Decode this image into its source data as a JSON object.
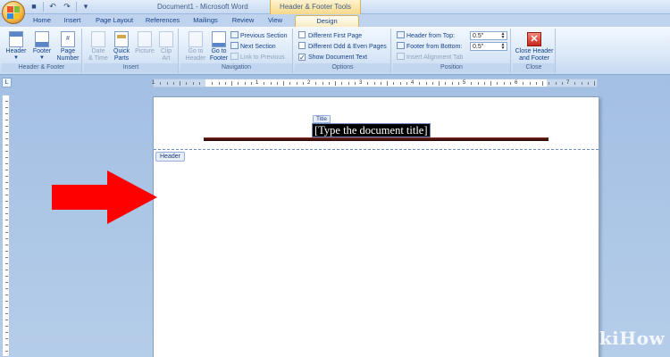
{
  "window": {
    "title": "Document1 - Microsoft Word",
    "contextual_tab_group": "Header & Footer Tools"
  },
  "quick_access": [
    "save-icon",
    "undo-icon",
    "redo-icon",
    "customize-icon"
  ],
  "tabs": [
    {
      "label": "Home",
      "active": false
    },
    {
      "label": "Insert",
      "active": false
    },
    {
      "label": "Page Layout",
      "active": false
    },
    {
      "label": "References",
      "active": false
    },
    {
      "label": "Mailings",
      "active": false
    },
    {
      "label": "Review",
      "active": false
    },
    {
      "label": "View",
      "active": false
    },
    {
      "label": "Design",
      "active": true
    }
  ],
  "ribbon": {
    "header_footer": {
      "label": "Header & Footer",
      "header": "Header",
      "footer": "Footer",
      "page_number_line1": "Page",
      "page_number_line2": "Number"
    },
    "insert": {
      "label": "Insert",
      "date_line1": "Date",
      "date_line2": "& Time",
      "quick_line1": "Quick",
      "quick_line2": "Parts",
      "picture": "Picture",
      "clip_line1": "Clip",
      "clip_line2": "Art"
    },
    "navigation": {
      "label": "Navigation",
      "goto_header_line1": "Go to",
      "goto_header_line2": "Header",
      "goto_footer_line1": "Go to",
      "goto_footer_line2": "Footer",
      "previous_section": "Previous Section",
      "next_section": "Next Section",
      "link_to_previous": "Link to Previous"
    },
    "options": {
      "label": "Options",
      "different_first_page": "Different First Page",
      "different_odd_even": "Different Odd & Even Pages",
      "show_document_text": "Show Document Text",
      "different_first_page_checked": false,
      "different_odd_even_checked": false,
      "show_document_text_checked": true
    },
    "position": {
      "label": "Position",
      "header_from_top_label": "Header from Top:",
      "header_from_top_value": "0.5\"",
      "footer_from_bottom_label": "Footer from Bottom:",
      "footer_from_bottom_value": "0.5\"",
      "insert_alignment_tab": "Insert Alignment Tab"
    },
    "close": {
      "label": "Close",
      "close_line1": "Close Header",
      "close_line2": "and Footer"
    }
  },
  "ruler_numbers": [
    "1",
    "1",
    "2",
    "3",
    "4",
    "5",
    "6",
    "7"
  ],
  "document": {
    "title_tag": "Title",
    "title_placeholder": "[Type the document title]",
    "header_tag": "Header"
  },
  "watermark": "wikiHow",
  "colors": {
    "ribbon_text": "#15428b",
    "contextual_tab": "#f5d98a",
    "arrow": "#ff0000",
    "header_rule": "#4a1510"
  }
}
